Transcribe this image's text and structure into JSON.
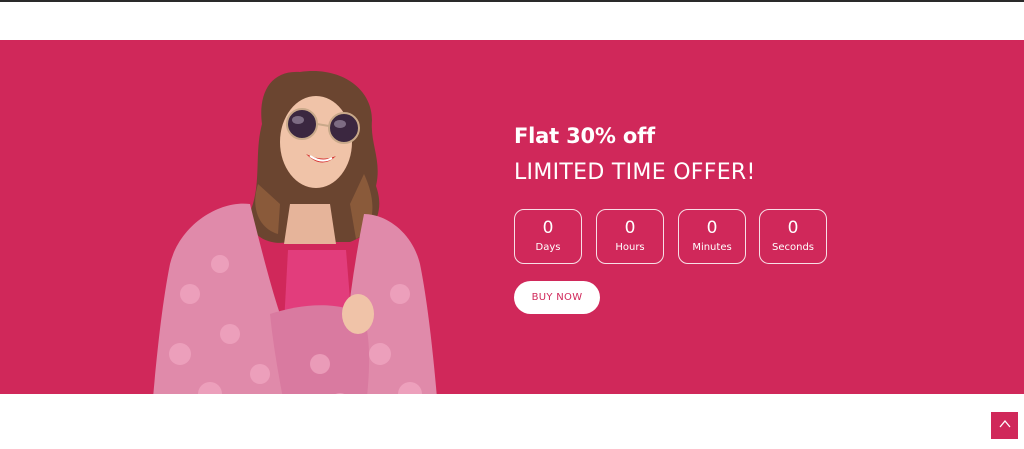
{
  "colors": {
    "accent": "#d0285a",
    "text_on_accent": "#ffffff",
    "background": "#ffffff"
  },
  "banner": {
    "title": "Flat 30% off",
    "subtitle": "LIMITED TIME OFFER!",
    "countdown": [
      {
        "value": "0",
        "label": "Days"
      },
      {
        "value": "0",
        "label": "Hours"
      },
      {
        "value": "0",
        "label": "Minutes"
      },
      {
        "value": "0",
        "label": "Seconds"
      }
    ],
    "button_label": "BUY NOW"
  },
  "icons": {
    "scroll_top": "chevron-up-icon"
  }
}
